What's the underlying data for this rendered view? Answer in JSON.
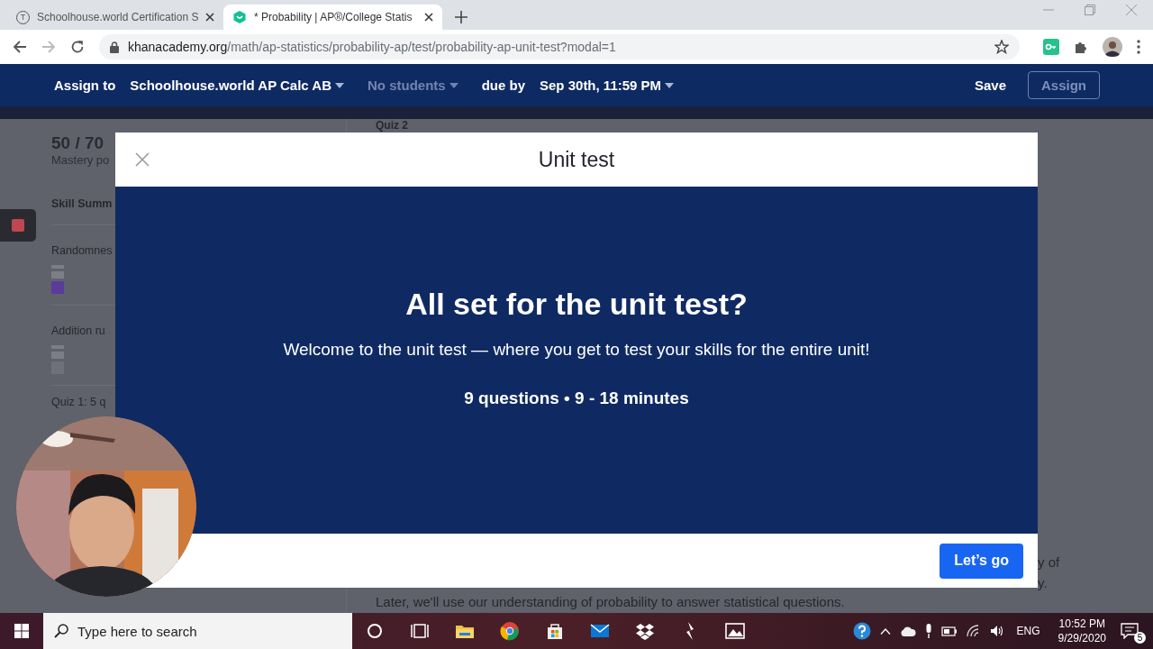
{
  "browser": {
    "tabs": [
      {
        "title": "Schoolhouse.world Certification S",
        "favicon_letter": "T",
        "selected": false
      },
      {
        "title": "* Probability | AP®/College Statis",
        "selected": true
      }
    ],
    "address": {
      "host": "khanacademy.org",
      "path": "/math/ap-statistics/probability-ap/test/probability-ap-unit-test?modal=1"
    }
  },
  "assign_bar": {
    "assign_label": "Assign to",
    "class_select": "Schoolhouse.world AP Calc AB",
    "students_select": {
      "label": "No students",
      "disabled": true
    },
    "due_label": "due by",
    "due_select": "Sep 30th, 11:59 PM",
    "save": "Save",
    "assign_button": {
      "label": "Assign",
      "disabled": true
    }
  },
  "background_page": {
    "score": "50 / 70",
    "score_caption": "Mastery po",
    "section_title": "Skill Summ",
    "skills": [
      {
        "name": "Randomnes",
        "color": "#5b3a9a"
      },
      {
        "name": "Addition ru",
        "color": "#6e717a"
      }
    ],
    "quiz": "Quiz 1: 5 q",
    "main_heading": "Quiz 2",
    "fragments": [
      "y of",
      "y."
    ],
    "paragraph": "Later, we'll use our understanding of probability to answer statistical questions."
  },
  "modal": {
    "title": "Unit test",
    "heading": "All set for the unit test?",
    "intro": "Welcome to the unit test — where you get to test your skills for the entire unit!",
    "meta": "9 questions • 9 - 18 minutes",
    "button": "Let’s go"
  },
  "taskbar": {
    "search_placeholder": "Type here to search",
    "apps": [
      {
        "kind": "cortana"
      },
      {
        "kind": "taskview"
      },
      {
        "kind": "folder"
      },
      {
        "kind": "chrome"
      },
      {
        "kind": "store"
      },
      {
        "kind": "mail"
      },
      {
        "kind": "dropbox"
      },
      {
        "kind": "bolt"
      },
      {
        "kind": "photos"
      }
    ],
    "language": "ENG",
    "time": "10:52 PM",
    "date": "9/29/2020",
    "notifications": "5"
  }
}
